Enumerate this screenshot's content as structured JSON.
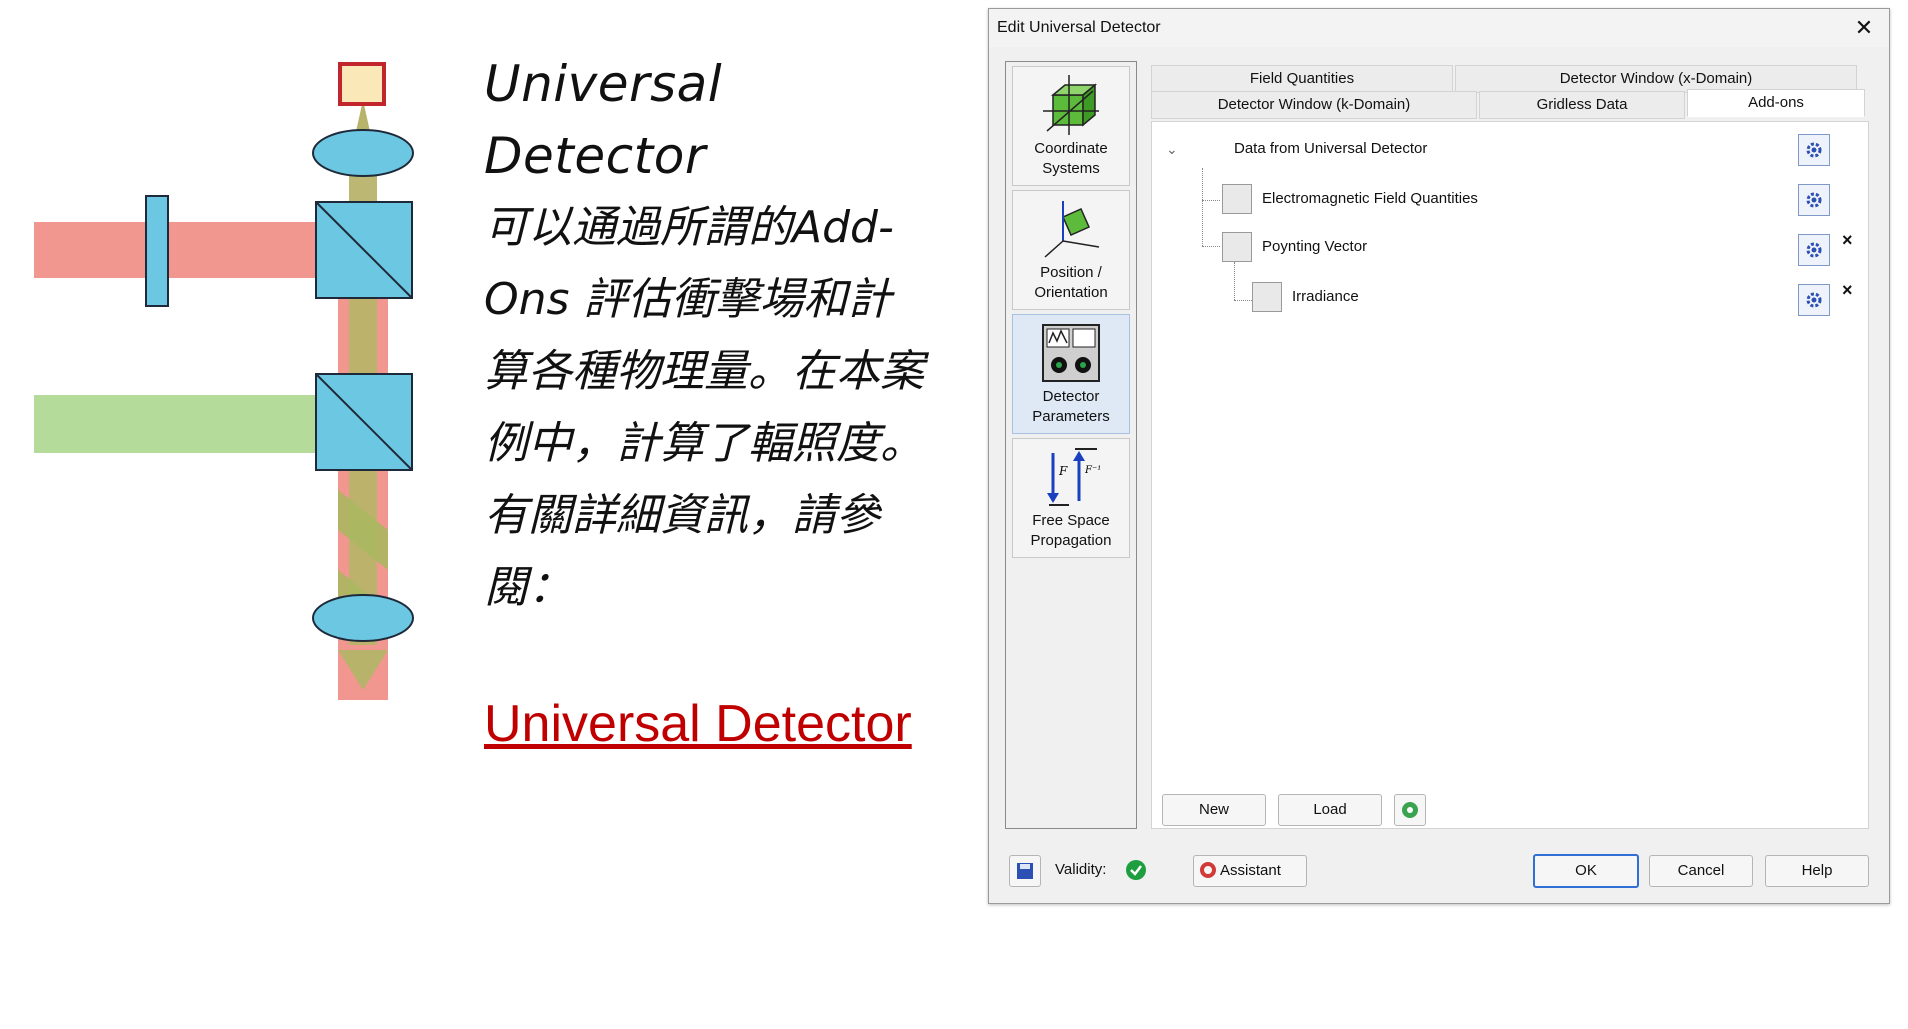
{
  "description": {
    "title": "Universal  Detector",
    "body": "可以通過所謂的Add-Ons 評估衝擊場和計算各種物理量。在本案例中，計算了輻照度。有關詳細資訊，請參閱：",
    "link": "Universal Detector"
  },
  "colors": {
    "red_beam": "#f29690",
    "green_beam": "#b5db9b",
    "optic_blue": "#6cc7e2",
    "detector_red": "#c0262c",
    "detector_fill": "#fbe8b8",
    "link_red": "#c00000",
    "check_green": "#1e9e3e"
  },
  "dialog": {
    "title": "Edit Universal Detector",
    "close_icon": "close-icon",
    "nav": [
      {
        "label": "Coordinate Systems",
        "icon": "coordinate-systems-icon"
      },
      {
        "label": "Position / Orientation",
        "icon": "position-orientation-icon"
      },
      {
        "label": "Detector Parameters",
        "icon": "detector-parameters-icon"
      },
      {
        "label": "Free Space Propagation",
        "icon": "free-space-propagation-icon"
      }
    ],
    "tabs_row1": [
      "Field Quantities",
      "Detector Window (x-Domain)"
    ],
    "tabs_row2": [
      "Detector Window (k-Domain)",
      "Gridless Data",
      "Add-ons"
    ],
    "active_tab": "Add-ons",
    "tree": {
      "root": "Data from Universal Detector",
      "items": [
        "Electromagnetic Field Quantities",
        "Poynting Vector",
        "Irradiance"
      ],
      "remove_mark": "×"
    },
    "buttons": {
      "new": "New",
      "load": "Load",
      "ok": "OK",
      "cancel": "Cancel",
      "help": "Help",
      "assistant": "Assistant"
    },
    "validity_label": "Validity:"
  }
}
